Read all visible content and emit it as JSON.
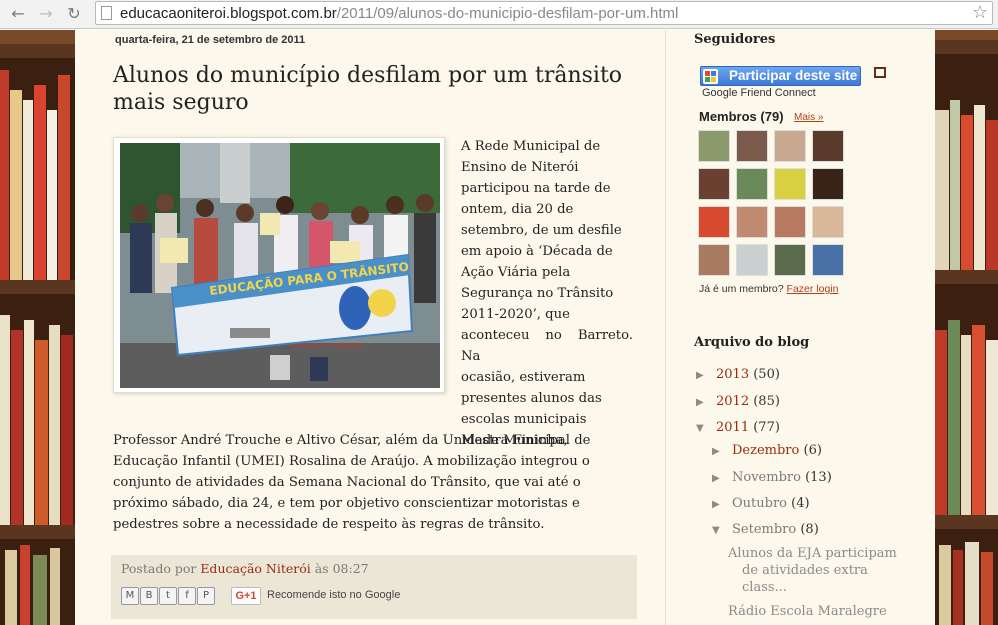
{
  "browser": {
    "url_domain": "educacaoniteroi.blogspot.com.br",
    "url_path": "/2011/09/alunos-do-municipio-desfilam-por-um.html"
  },
  "post": {
    "date": "quarta-feira, 21 de setembro de 2011",
    "title": "Alunos do município desfilam por um trânsito mais seguro",
    "photo_banner": "EDUCAÇÃO PARA O TRÂNSITO",
    "photo_sign": "ACIDENTE NO TRÂNSITO",
    "lines_right": [
      "A Rede Municipal de",
      "Ensino de Niterói",
      "participou na tarde de",
      "ontem, dia 20 de",
      "setembro, de um desfile",
      "em apoio à ‘Década de",
      "Ação Viária pela",
      "Segurança no Trânsito",
      "2011-2020’, que",
      "aconteceu no Barreto. Na",
      "ocasião, estiveram",
      "presentes alunos das",
      "escolas municipais",
      "Mestra Fininha,"
    ],
    "lines_full": [
      "Professor André Trouche e Altivo César, além da Unidade Municipal de",
      "Educação Infantil (UMEI) Rosalina de Araújo. A mobilização integrou o",
      "conjunto de atividades da Semana Nacional do Trânsito, que vai até o",
      "próximo sábado, dia 24, e tem por objetivo conscientizar motoristas e",
      "pedestres sobre a necessidade de respeito às regras de trânsito."
    ],
    "posted_by_label": "Postado por",
    "author": "Educação Niterói",
    "at_label": "às",
    "time": "08:27",
    "recommend": "Recomende isto no Google",
    "gplus": "G+1"
  },
  "sidebar": {
    "followers_title": "Seguidores",
    "join_label": "Participar deste site",
    "gfc": "Google Friend Connect",
    "members_label": "Membros (79)",
    "more_label": "Mais »",
    "login_prefix": "Já é um membro?",
    "login_link": "Fazer login",
    "archive_title": "Arquivo do blog",
    "archive": {
      "y2013": {
        "label": "2013",
        "count": "(50)"
      },
      "y2012": {
        "label": "2012",
        "count": "(85)"
      },
      "y2011": {
        "label": "2011",
        "count": "(77)"
      },
      "dez": {
        "label": "Dezembro",
        "count": "(6)"
      },
      "nov": {
        "label": "Novembro",
        "count": "(13)"
      },
      "out": {
        "label": "Outubro",
        "count": "(4)"
      },
      "set": {
        "label": "Setembro",
        "count": "(8)"
      },
      "post1_lines": [
        "Alunos da EJA participam",
        "de atividades extra",
        "class..."
      ],
      "post2_line": "Rádio Escola Maralegre"
    }
  }
}
